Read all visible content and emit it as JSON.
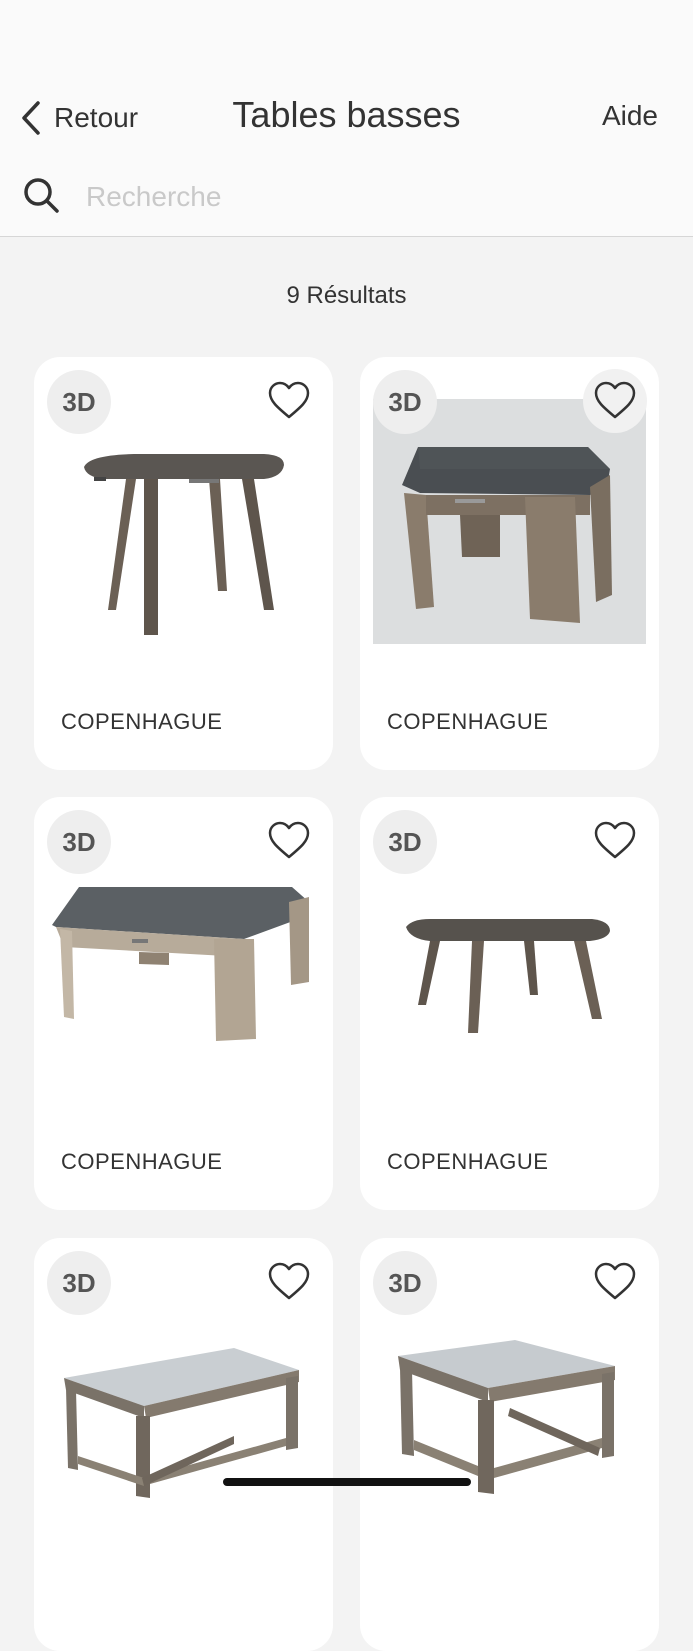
{
  "header": {
    "back_label": "Retour",
    "title": "Tables basses",
    "help_label": "Aide"
  },
  "search": {
    "placeholder": "Recherche",
    "value": ""
  },
  "results_text": "9 Résultats",
  "products": [
    {
      "badge": "3D",
      "name": "COPENHAGUE",
      "favorite": false
    },
    {
      "badge": "3D",
      "name": "COPENHAGUE",
      "favorite": false
    },
    {
      "badge": "3D",
      "name": "COPENHAGUE",
      "favorite": false
    },
    {
      "badge": "3D",
      "name": "COPENHAGUE",
      "favorite": false
    },
    {
      "badge": "3D",
      "name": ""
    },
    {
      "badge": "3D",
      "name": ""
    }
  ],
  "icons": {
    "back": "chevron-left-icon",
    "search": "search-icon",
    "favorite": "heart-outline-icon"
  },
  "colors": {
    "background": "#f3f3f3",
    "card": "#ffffff",
    "text": "#333333",
    "placeholder": "#c9c9c9",
    "badge_bg": "#eeeeee"
  }
}
